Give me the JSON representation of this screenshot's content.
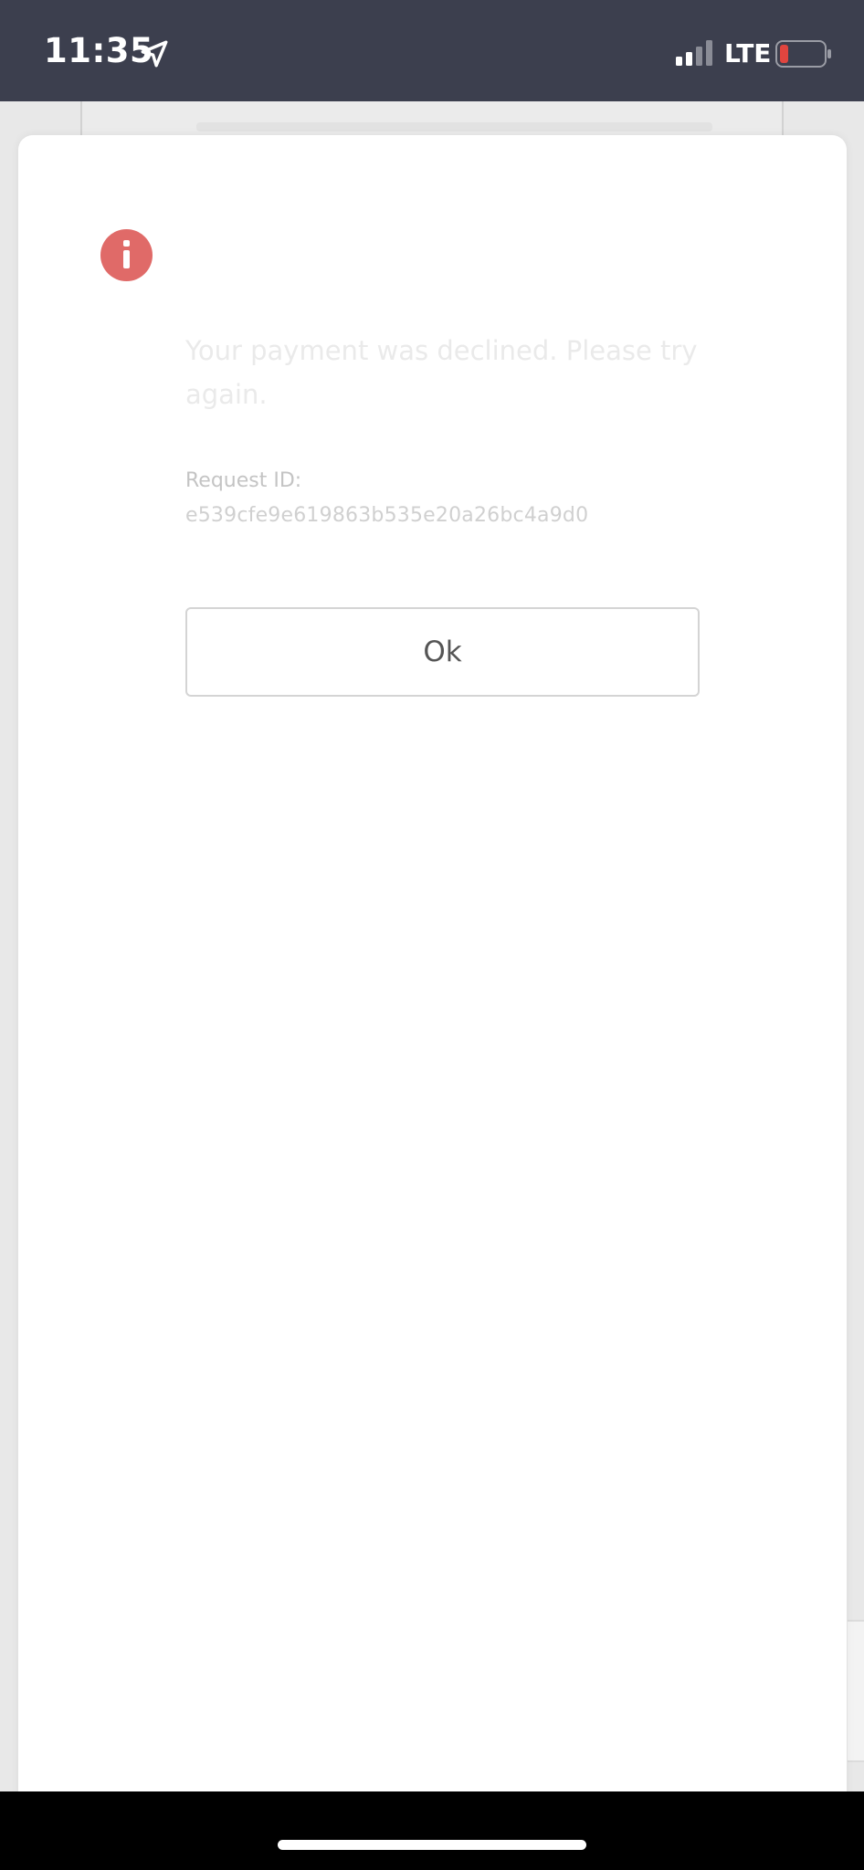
{
  "status_bar": {
    "time": "11:35",
    "network": "LTE",
    "battery_color": "#e0453f"
  },
  "dialog": {
    "icon": "info-icon",
    "icon_color": "#e06a68",
    "message": "Your payment was declined. Please try again.",
    "request_id_label": "Request ID:",
    "request_id_value": "e539cfe9e619863b535e20a26bc4a9d0",
    "ok_label": "Ok"
  }
}
